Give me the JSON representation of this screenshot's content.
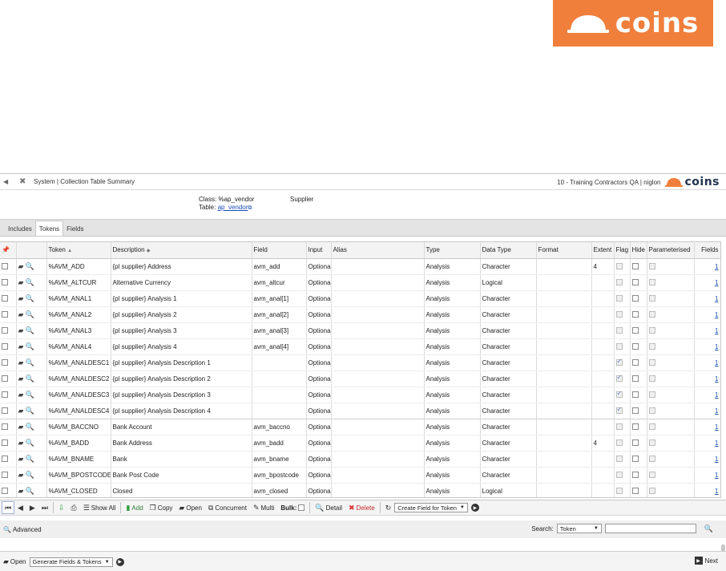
{
  "brand": {
    "name": "COINS",
    "display": "coins"
  },
  "titlebar": {
    "title": "System | Collection Table Summary",
    "company": "10 - Training Contractors QA | niglon"
  },
  "classinfo": {
    "class_label": "Class:",
    "class_value": "%ap_vendor",
    "class_desc": "Supplier",
    "table_label": "Table:",
    "table_value": "ap_vendor"
  },
  "tabs": [
    {
      "label": "Includes",
      "active": false
    },
    {
      "label": "Tokens",
      "active": true
    },
    {
      "label": "Fields",
      "active": false
    }
  ],
  "columns": [
    "Token",
    "Description",
    "Field",
    "Input",
    "Alias",
    "Type",
    "Data Type",
    "Format",
    "Extent",
    "Flag",
    "Hide",
    "Parameterised",
    "Fields"
  ],
  "rows": [
    {
      "token": "%AVM_ADD",
      "description": "{pl supplier} Address",
      "field": "avm_add",
      "input": "Optional",
      "alias": "",
      "type": "Analysis",
      "datatype": "Character",
      "format": "",
      "extent": "4",
      "flag": false,
      "flag_enabled": false,
      "fields": "1"
    },
    {
      "token": "%AVM_ALTCUR",
      "description": "Alternative Currency",
      "field": "avm_altcur",
      "input": "Optional",
      "alias": "",
      "type": "Analysis",
      "datatype": "Logical",
      "format": "",
      "extent": "",
      "flag": false,
      "flag_enabled": false,
      "fields": "1"
    },
    {
      "token": "%AVM_ANAL1",
      "description": "{pl supplier} Analysis 1",
      "field": "avm_anal[1]",
      "input": "Optional",
      "alias": "",
      "type": "Analysis",
      "datatype": "Character",
      "format": "",
      "extent": "",
      "flag": false,
      "flag_enabled": false,
      "fields": "1"
    },
    {
      "token": "%AVM_ANAL2",
      "description": "{pl supplier} Analysis 2",
      "field": "avm_anal[2]",
      "input": "Optional",
      "alias": "",
      "type": "Analysis",
      "datatype": "Character",
      "format": "",
      "extent": "",
      "flag": false,
      "flag_enabled": false,
      "fields": "1"
    },
    {
      "token": "%AVM_ANAL3",
      "description": "{pl supplier} Analysis 3",
      "field": "avm_anal[3]",
      "input": "Optional",
      "alias": "",
      "type": "Analysis",
      "datatype": "Character",
      "format": "",
      "extent": "",
      "flag": false,
      "flag_enabled": false,
      "fields": "1"
    },
    {
      "token": "%AVM_ANAL4",
      "description": "{pl supplier} Analysis 4",
      "field": "avm_anal[4]",
      "input": "Optional",
      "alias": "",
      "type": "Analysis",
      "datatype": "Character",
      "format": "",
      "extent": "",
      "flag": false,
      "flag_enabled": false,
      "fields": "1"
    },
    {
      "token": "%AVM_ANALDESC1",
      "description": "{pl supplier} Analysis Description 1",
      "field": "",
      "input": "Optional",
      "alias": "",
      "type": "Analysis",
      "datatype": "Character",
      "format": "",
      "extent": "",
      "flag": true,
      "flag_enabled": false,
      "fields": "1"
    },
    {
      "token": "%AVM_ANALDESC2",
      "description": "{pl supplier} Analysis Description 2",
      "field": "",
      "input": "Optional",
      "alias": "",
      "type": "Analysis",
      "datatype": "Character",
      "format": "",
      "extent": "",
      "flag": true,
      "flag_enabled": false,
      "fields": "1"
    },
    {
      "token": "%AVM_ANALDESC3",
      "description": "{pl supplier} Analysis Description 3",
      "field": "",
      "input": "Optional",
      "alias": "",
      "type": "Analysis",
      "datatype": "Character",
      "format": "",
      "extent": "",
      "flag": true,
      "flag_enabled": false,
      "fields": "1"
    },
    {
      "token": "%AVM_ANALDESC4",
      "description": "{pl supplier} Analysis Description 4",
      "field": "",
      "input": "Optional",
      "alias": "",
      "type": "Analysis",
      "datatype": "Character",
      "format": "",
      "extent": "",
      "flag": true,
      "flag_enabled": false,
      "fields": "1"
    },
    {
      "token": "%AVM_BACCNO",
      "description": "Bank Account",
      "field": "avm_baccno",
      "input": "Optional",
      "alias": "",
      "type": "Analysis",
      "datatype": "Character",
      "format": "",
      "extent": "",
      "flag": false,
      "flag_enabled": false,
      "fields": "1"
    },
    {
      "token": "%AVM_BADD",
      "description": "Bank Address",
      "field": "avm_badd",
      "input": "Optional",
      "alias": "",
      "type": "Analysis",
      "datatype": "Character",
      "format": "",
      "extent": "4",
      "flag": false,
      "flag_enabled": false,
      "fields": "1"
    },
    {
      "token": "%AVM_BNAME",
      "description": "Bank",
      "field": "avm_bname",
      "input": "Optional",
      "alias": "",
      "type": "Analysis",
      "datatype": "Character",
      "format": "",
      "extent": "",
      "flag": false,
      "flag_enabled": false,
      "fields": "1"
    },
    {
      "token": "%AVM_BPOSTCODE",
      "description": "Bank Post Code",
      "field": "avm_bpostcode",
      "input": "Optional",
      "alias": "",
      "type": "Analysis",
      "datatype": "Character",
      "format": "",
      "extent": "",
      "flag": false,
      "flag_enabled": false,
      "fields": "1"
    },
    {
      "token": "%AVM_CLOSED",
      "description": "Closed",
      "field": "avm_closed",
      "input": "Optional",
      "alias": "",
      "type": "Analysis",
      "datatype": "Logical",
      "format": "",
      "extent": "",
      "flag": false,
      "flag_enabled": false,
      "fields": "1"
    }
  ],
  "toolbar": {
    "show_all": "Show All",
    "add": "Add",
    "copy": "Copy",
    "open": "Open",
    "concurrent": "Concurrent",
    "multi": "Multi",
    "bulk": "Bulk:",
    "detail": "Detail",
    "delete": "Delete",
    "action_select": "Create Field for Token"
  },
  "advbar": {
    "advanced": "Advanced",
    "search_label": "Search:",
    "search_field": "Token",
    "search_value": ""
  },
  "footbar": {
    "open": "Open",
    "action_select": "Generate Fields & Tokens",
    "next": "Next"
  },
  "colors": {
    "brand_orange": "#f07f3c",
    "brand_navy": "#23344f",
    "link": "#1a4fb5"
  }
}
